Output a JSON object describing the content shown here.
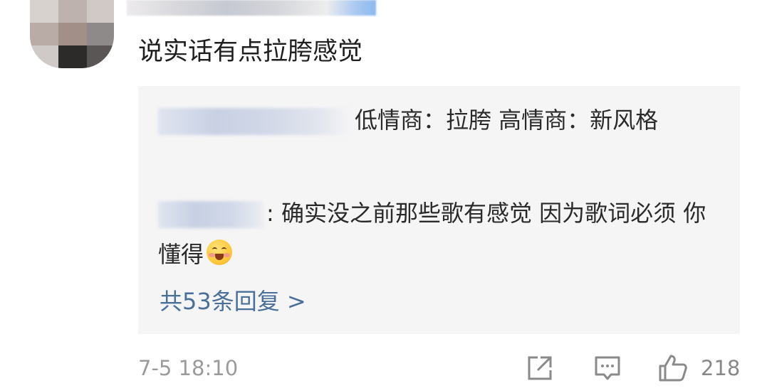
{
  "comment": {
    "text": "说实话有点拉胯感觉",
    "timestamp": "7-5 18:10",
    "like_count": "218"
  },
  "replies": [
    {
      "text": "低情商：拉胯 高情商：新风格"
    },
    {
      "text": ": 确实没之前那些歌有感觉 因为歌词必须 你懂得",
      "emoji": "smiling-face-with-hands-emoji"
    }
  ],
  "more_replies": "共53条回复 >",
  "icons": [
    "share-icon",
    "comment-icon",
    "like-icon"
  ],
  "colors": {
    "link": "#4a6f99",
    "reply_bg": "#f5f5f6",
    "meta": "#9b9b9b"
  }
}
